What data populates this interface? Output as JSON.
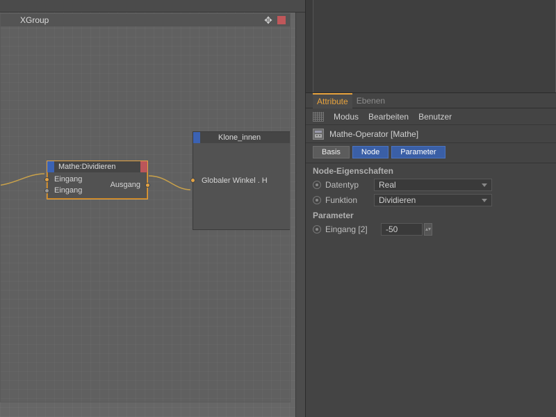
{
  "group": {
    "title": "XGroup"
  },
  "node_math": {
    "title": "Mathe:Dividieren",
    "in1": "Eingang",
    "in2": "Eingang",
    "out": "Ausgang"
  },
  "node_clone": {
    "title": "Klone_innen",
    "port": "Globaler Winkel . H"
  },
  "attr": {
    "tabs": {
      "attribute": "Attribute",
      "ebenen": "Ebenen"
    },
    "menu": {
      "modus": "Modus",
      "bearbeiten": "Bearbeiten",
      "benutzer": "Benutzer"
    },
    "object_label": "Mathe-Operator [Mathe]",
    "chips": {
      "basis": "Basis",
      "node": "Node",
      "parameter": "Parameter"
    },
    "section_node": "Node-Eigenschaften",
    "datentyp_label": "Datentyp",
    "datentyp_value": "Real",
    "funktion_label": "Funktion",
    "funktion_value": "Dividieren",
    "section_param": "Parameter",
    "eingang2_label": "Eingang [2]",
    "eingang2_value": "-50"
  }
}
